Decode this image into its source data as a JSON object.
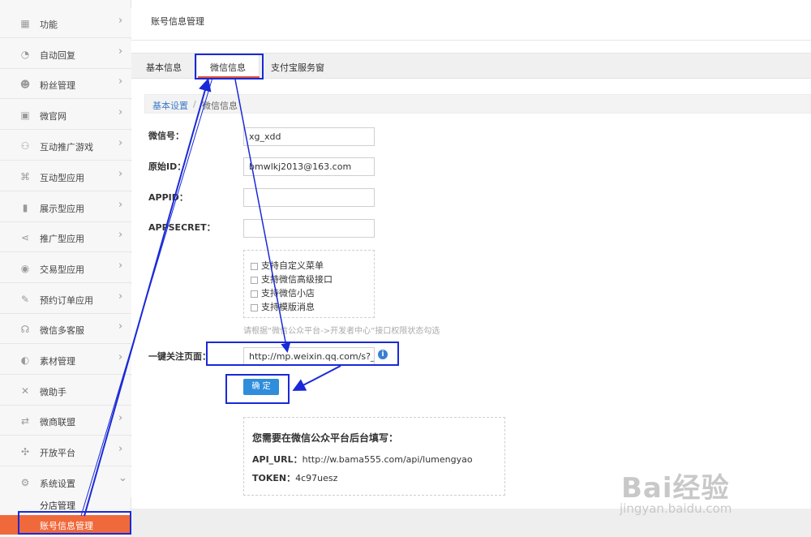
{
  "header": {
    "title": "账号信息管理"
  },
  "sidebar": {
    "items": [
      {
        "label": "功能",
        "icon": "grid-icon",
        "glyph": "▦"
      },
      {
        "label": "自动回复",
        "icon": "chat-icon",
        "glyph": "◔"
      },
      {
        "label": "粉丝管理",
        "icon": "users-icon",
        "glyph": "☻"
      },
      {
        "label": "微官网",
        "icon": "website-icon",
        "glyph": "▣"
      },
      {
        "label": "互动推广游戏",
        "icon": "gamepad-icon",
        "glyph": "⚇"
      },
      {
        "label": "互动型应用",
        "icon": "command-icon",
        "glyph": "⌘"
      },
      {
        "label": "展示型应用",
        "icon": "book-icon",
        "glyph": "▮"
      },
      {
        "label": "推广型应用",
        "icon": "share-icon",
        "glyph": "⋖"
      },
      {
        "label": "交易型应用",
        "icon": "trade-icon",
        "glyph": "◉"
      },
      {
        "label": "预约订单应用",
        "icon": "edit-icon",
        "glyph": "✎"
      },
      {
        "label": "微信多客服",
        "icon": "headset-icon",
        "glyph": "☊"
      },
      {
        "label": "素材管理",
        "icon": "palette-icon",
        "glyph": "◐"
      },
      {
        "label": "微助手",
        "icon": "tools-icon",
        "glyph": "✕"
      },
      {
        "label": "微商联盟",
        "icon": "shuffle-icon",
        "glyph": "⇄"
      },
      {
        "label": "开放平台",
        "icon": "puzzle-icon",
        "glyph": "✣"
      },
      {
        "label": "系统设置",
        "icon": "gear-icon",
        "glyph": "⚙"
      }
    ],
    "sub_items": [
      {
        "label": "分店管理"
      },
      {
        "label": "账号信息管理"
      }
    ]
  },
  "tabs": [
    {
      "label": "基本信息"
    },
    {
      "label": "微信信息"
    },
    {
      "label": "支付宝服务窗"
    }
  ],
  "breadcrumb": {
    "first": "基本设置",
    "separator": "/",
    "current": "微信信息"
  },
  "form": {
    "wechat_id": {
      "label": "微信号：",
      "value": "xg_xdd"
    },
    "original_id": {
      "label": "原始ID：",
      "value": "bmwlkj2013@163.com"
    },
    "appid": {
      "label": "APPID：",
      "value": ""
    },
    "appsecret": {
      "label": "APPSECRET：",
      "value": ""
    },
    "checkboxes": [
      {
        "label": "支持自定义菜单"
      },
      {
        "label": "支持微信高级接口"
      },
      {
        "label": "支持微信小店"
      },
      {
        "label": "支持模版消息"
      }
    ],
    "hint": "请根据“微信公众平台->开发者中心”接口权限状态勾选",
    "follow_page": {
      "label": "一键关注页面：",
      "value": "http://mp.weixin.qq.com/s?__bi"
    },
    "submit_label": "确 定"
  },
  "api_info": {
    "title": "您需要在微信公众平台后台填写：",
    "api_url_label": "API_URL：",
    "api_url": "http://w.bama555.com/api/lumengyao",
    "token_label": "TOKEN：",
    "token": "4c97uesz"
  },
  "watermark": {
    "brand": "Bai经验",
    "domain": "jingyan.baidu.com"
  },
  "colors": {
    "highlight": "#1a29d8",
    "active_sidebar": "#f0693b",
    "tab_underline": "#e0533b",
    "primary_button": "#2f8ddc",
    "link": "#3d7cc9"
  }
}
